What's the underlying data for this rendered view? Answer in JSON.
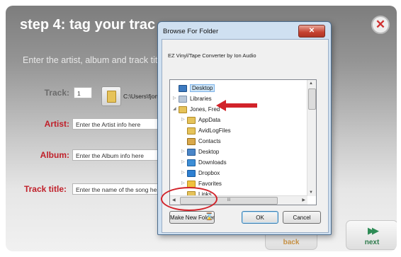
{
  "app": {
    "title": "step 4: tag your trac",
    "close_glyph": "✕",
    "subtitle": "Enter the artist, album and track titl",
    "colors": {
      "label_gray": "#6b6b6b",
      "label_red": "#c0202a",
      "annotation_red": "#d2232a",
      "selection": "#cce4f7"
    }
  },
  "fields": {
    "track_label": "Track:",
    "track_value": "1",
    "track_path": "C:\\Users\\fjon",
    "artist_label": "Artist:",
    "artist_value": "Enter the Artist info here",
    "album_label": "Album:",
    "album_value": "Enter the Album info here",
    "title_label": "Track title:",
    "title_value": "Enter the name of the song her"
  },
  "nav": {
    "back_label": "back",
    "next_label": "next",
    "next_icon": "fast-forward-icon",
    "next_glyph": "▶▶"
  },
  "dialog": {
    "title": "Browse For Folder",
    "close_glyph": "✕",
    "description": "EZ Vinyl/Tape Converter by Ion Audio",
    "tree": [
      {
        "label": "Desktop",
        "icon": "desktop-icon",
        "selected": true,
        "expander": ""
      },
      {
        "label": "Libraries",
        "icon": "library-icon",
        "selected": false,
        "expander": "▷"
      },
      {
        "label": "Jones, Fred",
        "icon": "user-folder-icon",
        "selected": false,
        "expander": "◢"
      },
      {
        "label": "AppData",
        "icon": "folder-icon",
        "selected": false,
        "expander": "▷"
      },
      {
        "label": "AvidLogFiles",
        "icon": "folder-icon",
        "selected": false,
        "expander": ""
      },
      {
        "label": "Contacts",
        "icon": "contacts-icon",
        "selected": false,
        "expander": ""
      },
      {
        "label": "Desktop",
        "icon": "desktop-folder-icon",
        "selected": false,
        "expander": "▷"
      },
      {
        "label": "Downloads",
        "icon": "downloads-icon",
        "selected": false,
        "expander": "▷"
      },
      {
        "label": "Dropbox",
        "icon": "dropbox-icon",
        "selected": false,
        "expander": "▷"
      },
      {
        "label": "Favorites",
        "icon": "favorites-icon",
        "selected": false,
        "expander": "▷"
      },
      {
        "label": "Links",
        "icon": "links-icon",
        "selected": false,
        "expander": ""
      }
    ],
    "hscroll_grip": "III",
    "buttons": {
      "make_new_folder": "Make New Folder",
      "ok": "OK",
      "cancel": "Cancel"
    },
    "cursor_icon": "hourglass-icon"
  }
}
